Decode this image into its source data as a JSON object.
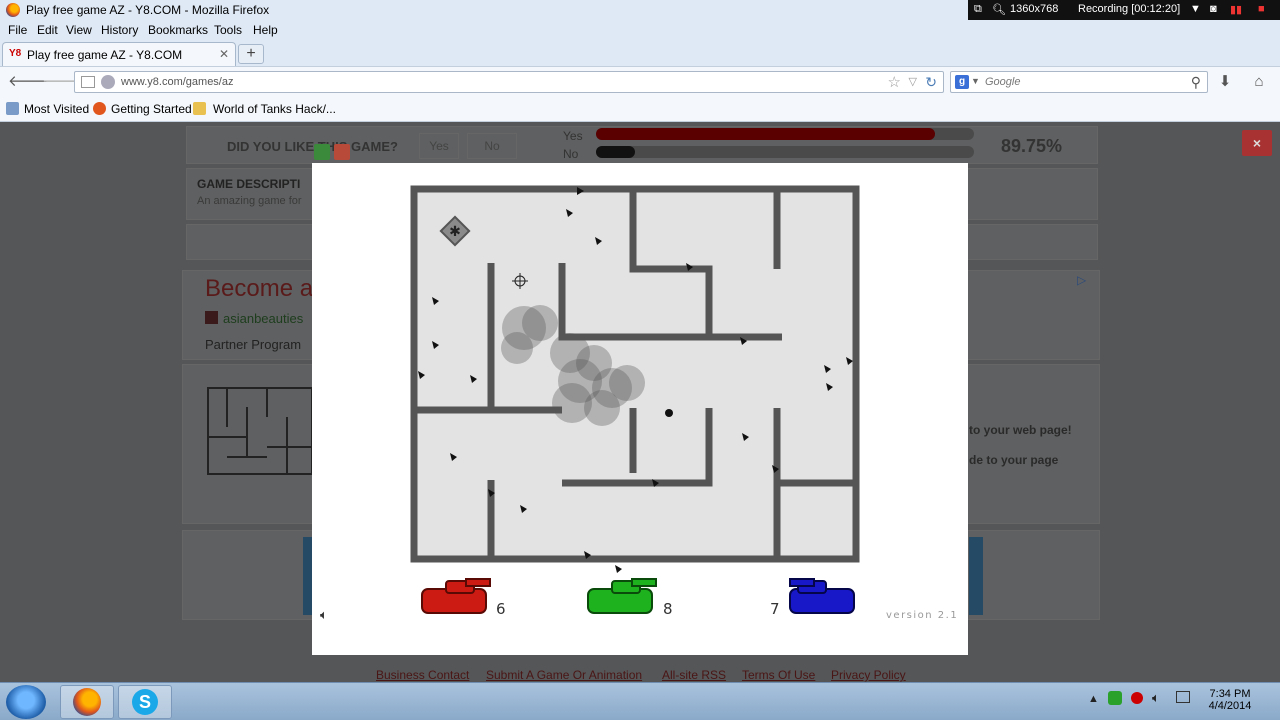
{
  "window": {
    "title": "Play free game AZ - Y8.COM - Mozilla Firefox"
  },
  "recorder": {
    "resolution": "1360x768",
    "status": "Recording [00:12:20]"
  },
  "menu": [
    "File",
    "Edit",
    "View",
    "History",
    "Bookmarks",
    "Tools",
    "Help"
  ],
  "tab": {
    "favicon": "Y8",
    "title": "Play free game AZ - Y8.COM",
    "new_tab": "+"
  },
  "nav": {
    "url": "www.y8.com/games/az",
    "search_placeholder": "Google",
    "search_engine": "g"
  },
  "bookmarks": [
    "Most Visited",
    "Getting Started",
    "World of Tanks Hack/..."
  ],
  "page": {
    "rating_question": "DID YOU LIKE THIS GAME?",
    "yes_button": "Yes",
    "no_button": "No",
    "yes_label": "Yes",
    "no_label": "No",
    "yes_fraction": 0.8975,
    "rating_percent": "89.75%",
    "desc_title": "GAME DESCRIPTI",
    "desc_text": "An amazing game for",
    "ad_title": "Become a",
    "ad_link": "asianbeauties",
    "ad_partner": "Partner Program",
    "embed_line1": "to your web page!",
    "embed_line2": "de to your page",
    "close_label": "×"
  },
  "game": {
    "scores": {
      "red": "6",
      "green": "8",
      "blue": "7"
    },
    "version": "version 2.1",
    "colors": {
      "red": "#cc1b12",
      "green": "#1fb21f",
      "blue": "#1818c8",
      "wall": "#555555",
      "floor": "#e3e3e3"
    }
  },
  "footer_links": [
    "Business Contact",
    "Submit A Game Or Animation",
    "All-site RSS",
    "Terms Of Use",
    "Privacy Policy"
  ],
  "taskbar": {
    "time": "7:34 PM",
    "date": "4/4/2014"
  }
}
